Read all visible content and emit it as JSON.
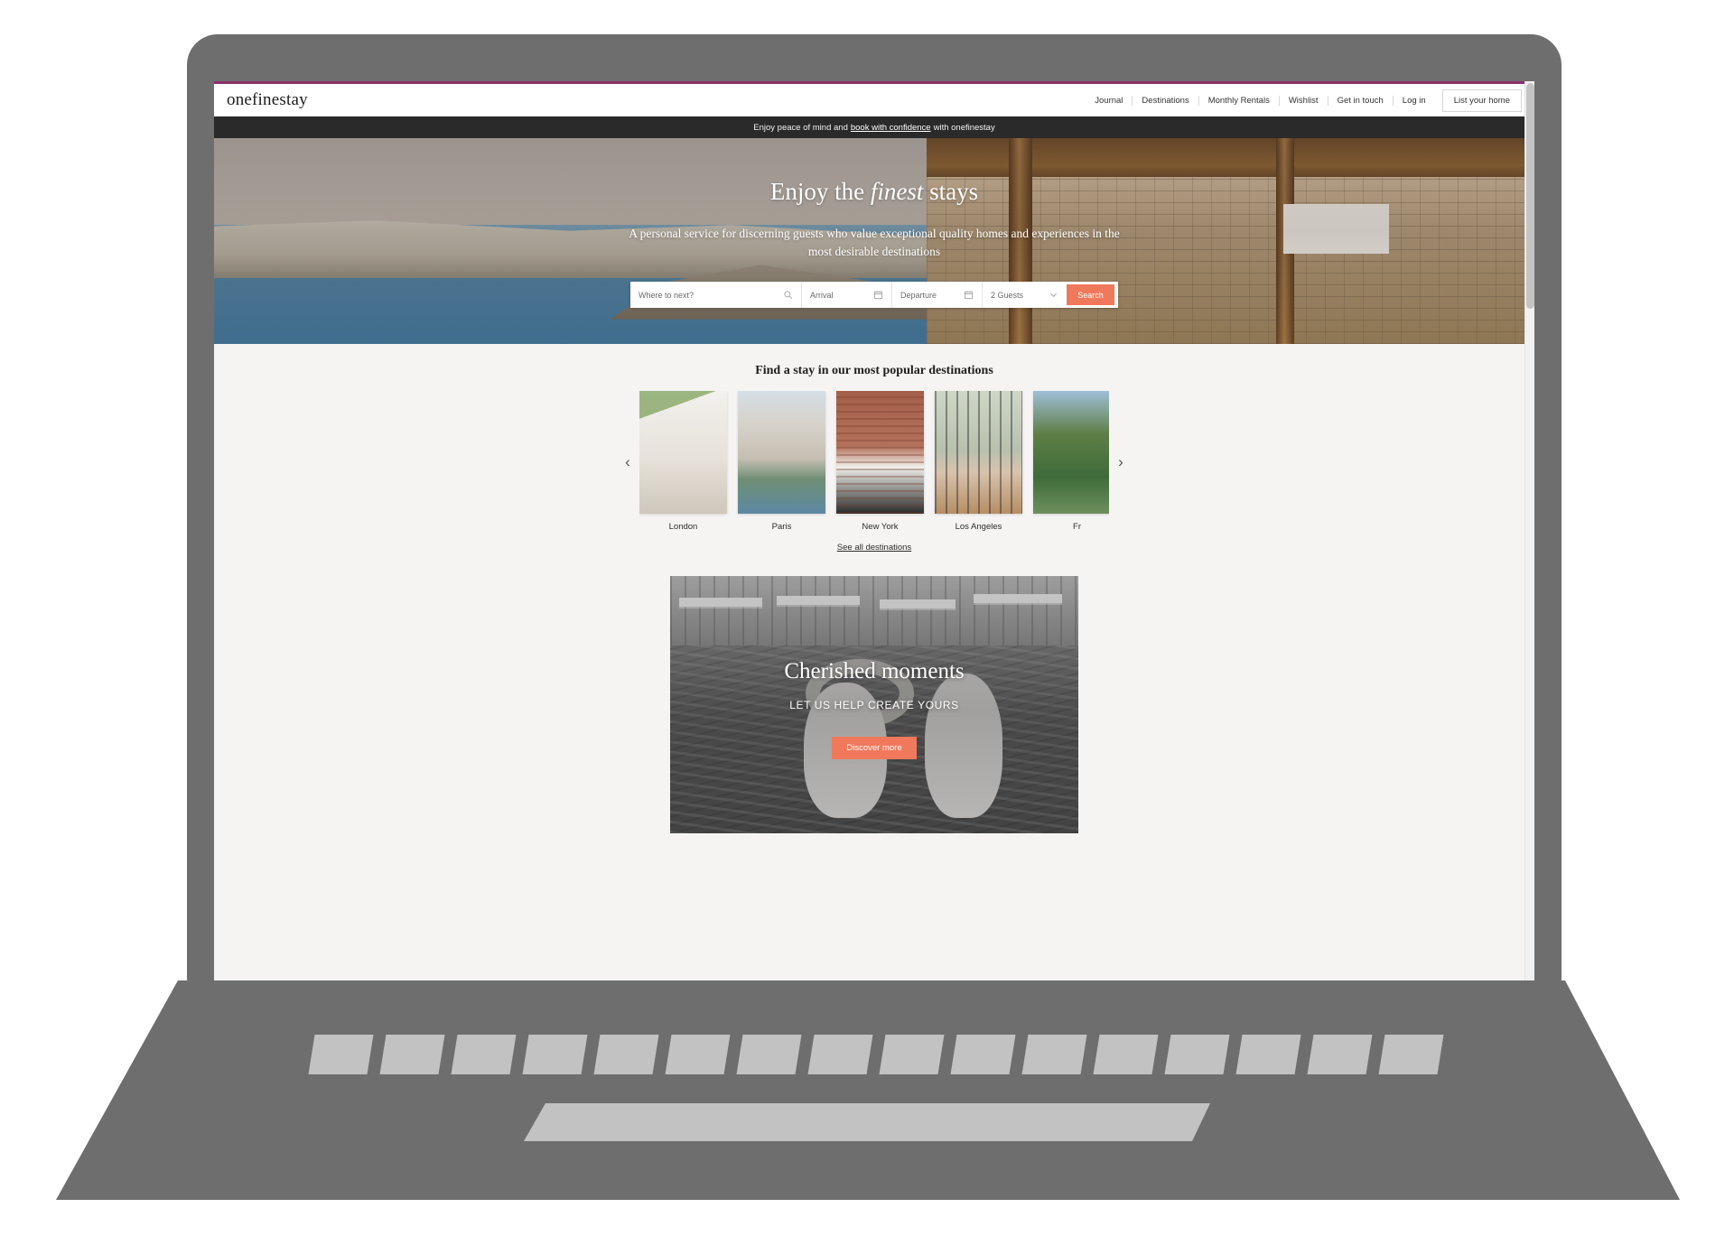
{
  "brand": {
    "logo_text": "onefinestay",
    "accent_color": "#8c2f6b",
    "cta_color": "#f0795c"
  },
  "header": {
    "nav_items": [
      {
        "label": "Journal"
      },
      {
        "label": "Destinations"
      },
      {
        "label": "Monthly Rentals"
      },
      {
        "label": "Wishlist"
      },
      {
        "label": "Get in touch"
      },
      {
        "label": "Log in"
      }
    ],
    "cta_label": "List your home"
  },
  "announcement": {
    "prefix": "Enjoy peace of mind and",
    "link_text": "book with confidence",
    "suffix": "with onefinestay"
  },
  "hero": {
    "title_part1": "Enjoy the ",
    "title_emphasis": "finest",
    "title_part2": " stays",
    "subtitle": "A personal service for discerning guests who value exceptional quality homes and experiences in the most desirable destinations"
  },
  "search": {
    "destination_placeholder": "Where to next?",
    "arrival_placeholder": "Arrival",
    "departure_placeholder": "Departure",
    "guests_value": "2 Guests",
    "submit_label": "Search"
  },
  "destinations": {
    "title": "Find a stay in our most popular destinations",
    "prev_label": "‹",
    "next_label": "›",
    "cards": [
      {
        "label": "London"
      },
      {
        "label": "Paris"
      },
      {
        "label": "New York"
      },
      {
        "label": "Los Angeles"
      },
      {
        "label": "Fr"
      }
    ],
    "see_all_label": "See all destinations"
  },
  "moments": {
    "title": "Cherished moments",
    "subtitle": "LET US HELP CREATE YOURS",
    "cta_label": "Discover more"
  }
}
